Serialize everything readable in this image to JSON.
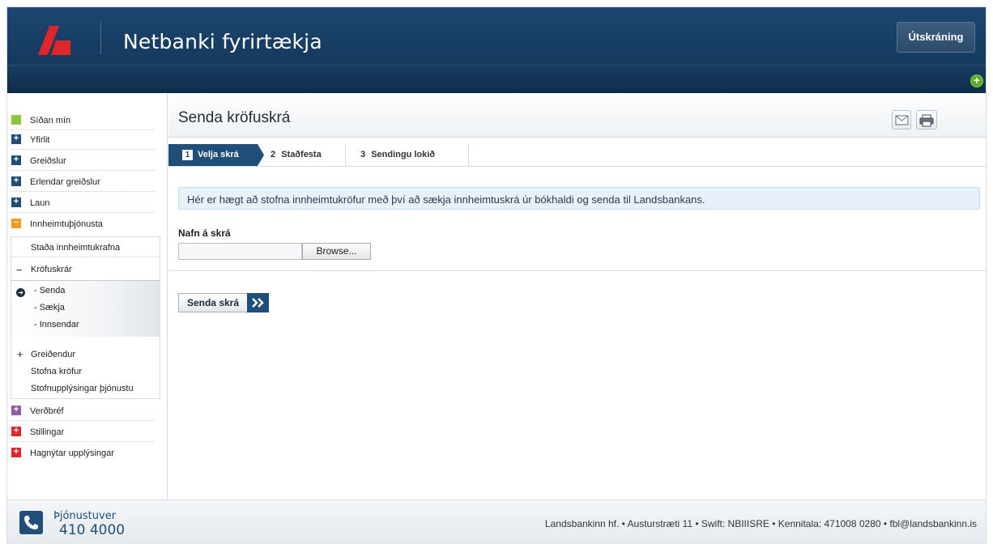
{
  "header": {
    "app_title": "Netbanki fyrirtækja",
    "logout_label": "Útskráning",
    "brand_color": "#e0262a",
    "header_color": "#173d62"
  },
  "sidebar": {
    "items": [
      {
        "label": "Síðan mín",
        "icon": "green-square",
        "color": "#8cc63f"
      },
      {
        "label": "Yfirlit",
        "icon": "plus",
        "color": "#1f4e78"
      },
      {
        "label": "Greiðslur",
        "icon": "plus",
        "color": "#1f4e78"
      },
      {
        "label": "Erlendar greiðslur",
        "icon": "plus",
        "color": "#1f4e78"
      },
      {
        "label": "Laun",
        "icon": "plus",
        "color": "#1f4e78"
      },
      {
        "label": "Innheimtuþjónusta",
        "icon": "minus",
        "color": "#f39c1f",
        "expanded": true
      }
    ],
    "submenu": {
      "status": "Staða innheimtukrafna",
      "claim_files": "Kröfuskrár",
      "claim_children": [
        "- Senda",
        "- Sækja",
        "- Innsendar"
      ],
      "payers": "Greiðendur",
      "create_claims": "Stofna kröfur",
      "service_info": "Stofnupplýsingar þjónustu"
    },
    "items_after": [
      {
        "label": "Verðbréf",
        "icon": "plus",
        "color": "#8e5ca6"
      },
      {
        "label": "Stillingar",
        "icon": "plus",
        "color": "#e0262a"
      },
      {
        "label": "Hagnýtar upplýsingar",
        "icon": "plus",
        "color": "#e0262a"
      }
    ]
  },
  "main": {
    "page_title": "Senda kröfuskrá",
    "icons": [
      "mail-icon",
      "print-icon"
    ],
    "steps": [
      {
        "number": "1",
        "label": "Velja skrá",
        "active": true
      },
      {
        "number": "2",
        "label": "Staðfesta",
        "active": false
      },
      {
        "number": "3",
        "label": "Sendingu lokið",
        "active": false
      }
    ],
    "info_text": "Hér er hægt að stofna innheimtukröfur með því að sækja innheimtuskrá úr bókhaldi og senda til Landsbankans.",
    "file_label": "Nafn á skrá",
    "file_value": "",
    "browse_label": "Browse...",
    "send_label": "Senda skrá"
  },
  "footer": {
    "service_label": "Þjónustuver",
    "service_phone": "410 4000",
    "company_info": "Landsbankinn hf.  • Austurstræti 11  • Swift: NBIIISRE  • Kennitala:  471008 0280  • fbl@landsbankinn.is"
  }
}
